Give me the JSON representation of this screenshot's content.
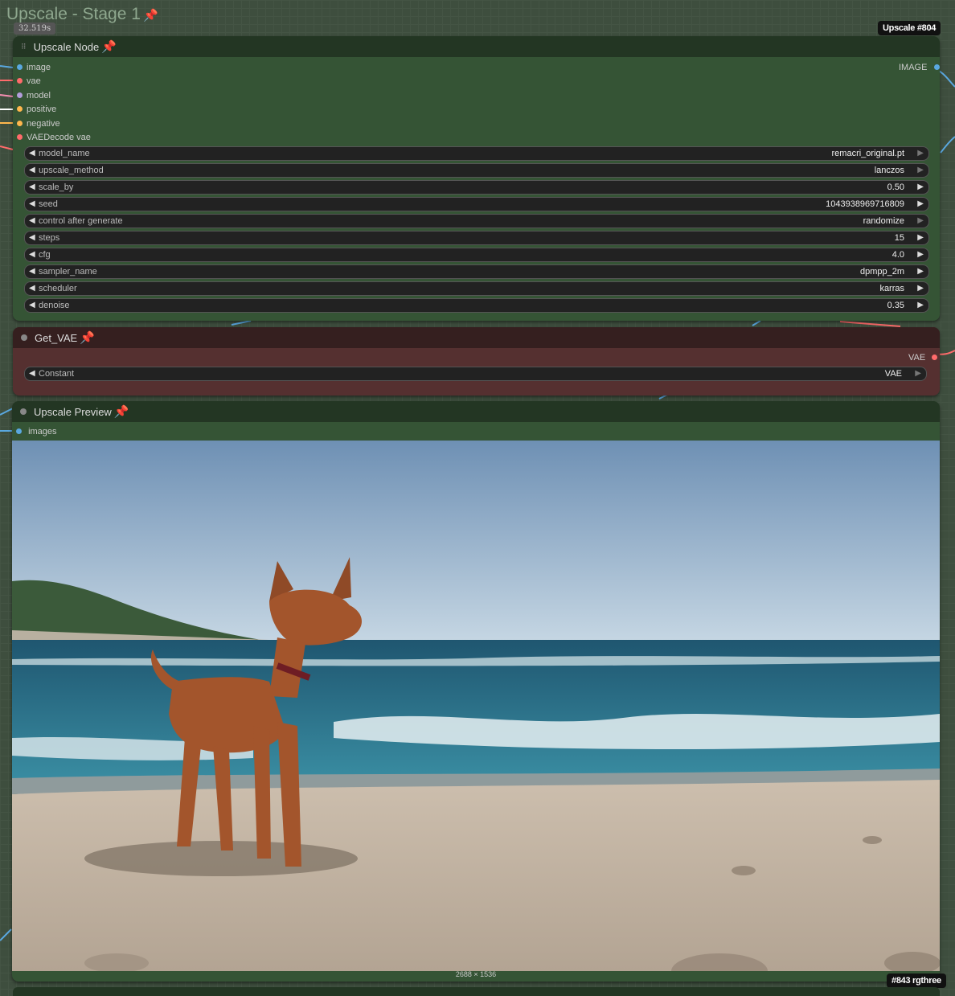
{
  "group": {
    "title": "Upscale - Stage 1",
    "timer": "32.519s"
  },
  "badges": {
    "upscale_name": "Upscale",
    "upscale_id": "#804",
    "preview_badge": "#843 rgthree"
  },
  "upscale_node": {
    "title": "Upscale Node",
    "inputs": [
      {
        "label": "image",
        "color": "#5aa8e0"
      },
      {
        "label": "vae",
        "color": "#ff6b6b"
      },
      {
        "label": "model",
        "color": "#b39ddb"
      },
      {
        "label": "positive",
        "color": "#ffb74d"
      },
      {
        "label": "negative",
        "color": "#ffb74d"
      },
      {
        "label": "VAEDecode vae",
        "color": "#ff6b6b"
      }
    ],
    "output": {
      "label": "IMAGE",
      "color": "#5aa8e0"
    },
    "widgets": [
      {
        "label": "model_name",
        "value": "remacri_original.pt"
      },
      {
        "label": "upscale_method",
        "value": "lanczos"
      },
      {
        "label": "scale_by",
        "value": "0.50"
      },
      {
        "label": "seed",
        "value": "1043938969716809"
      },
      {
        "label": "control after generate",
        "value": "randomize"
      },
      {
        "label": "steps",
        "value": "15"
      },
      {
        "label": "cfg",
        "value": "4.0"
      },
      {
        "label": "sampler_name",
        "value": "dpmpp_2m"
      },
      {
        "label": "scheduler",
        "value": "karras"
      },
      {
        "label": "denoise",
        "value": "0.35"
      }
    ]
  },
  "get_vae": {
    "title": "Get_VAE",
    "output": {
      "label": "VAE",
      "color": "#ff6b6b"
    },
    "widget": {
      "label": "Constant",
      "value": "VAE"
    }
  },
  "preview": {
    "title": "Upscale Preview",
    "input": {
      "label": "images",
      "color": "#5aa8e0"
    },
    "dimensions": "2688 × 1536"
  },
  "colors": {
    "green_node_body": "#355435",
    "green_node_header": "#233623",
    "red_node_body": "#553030",
    "red_node_header": "#351f1f",
    "pin": "#e2233a"
  }
}
